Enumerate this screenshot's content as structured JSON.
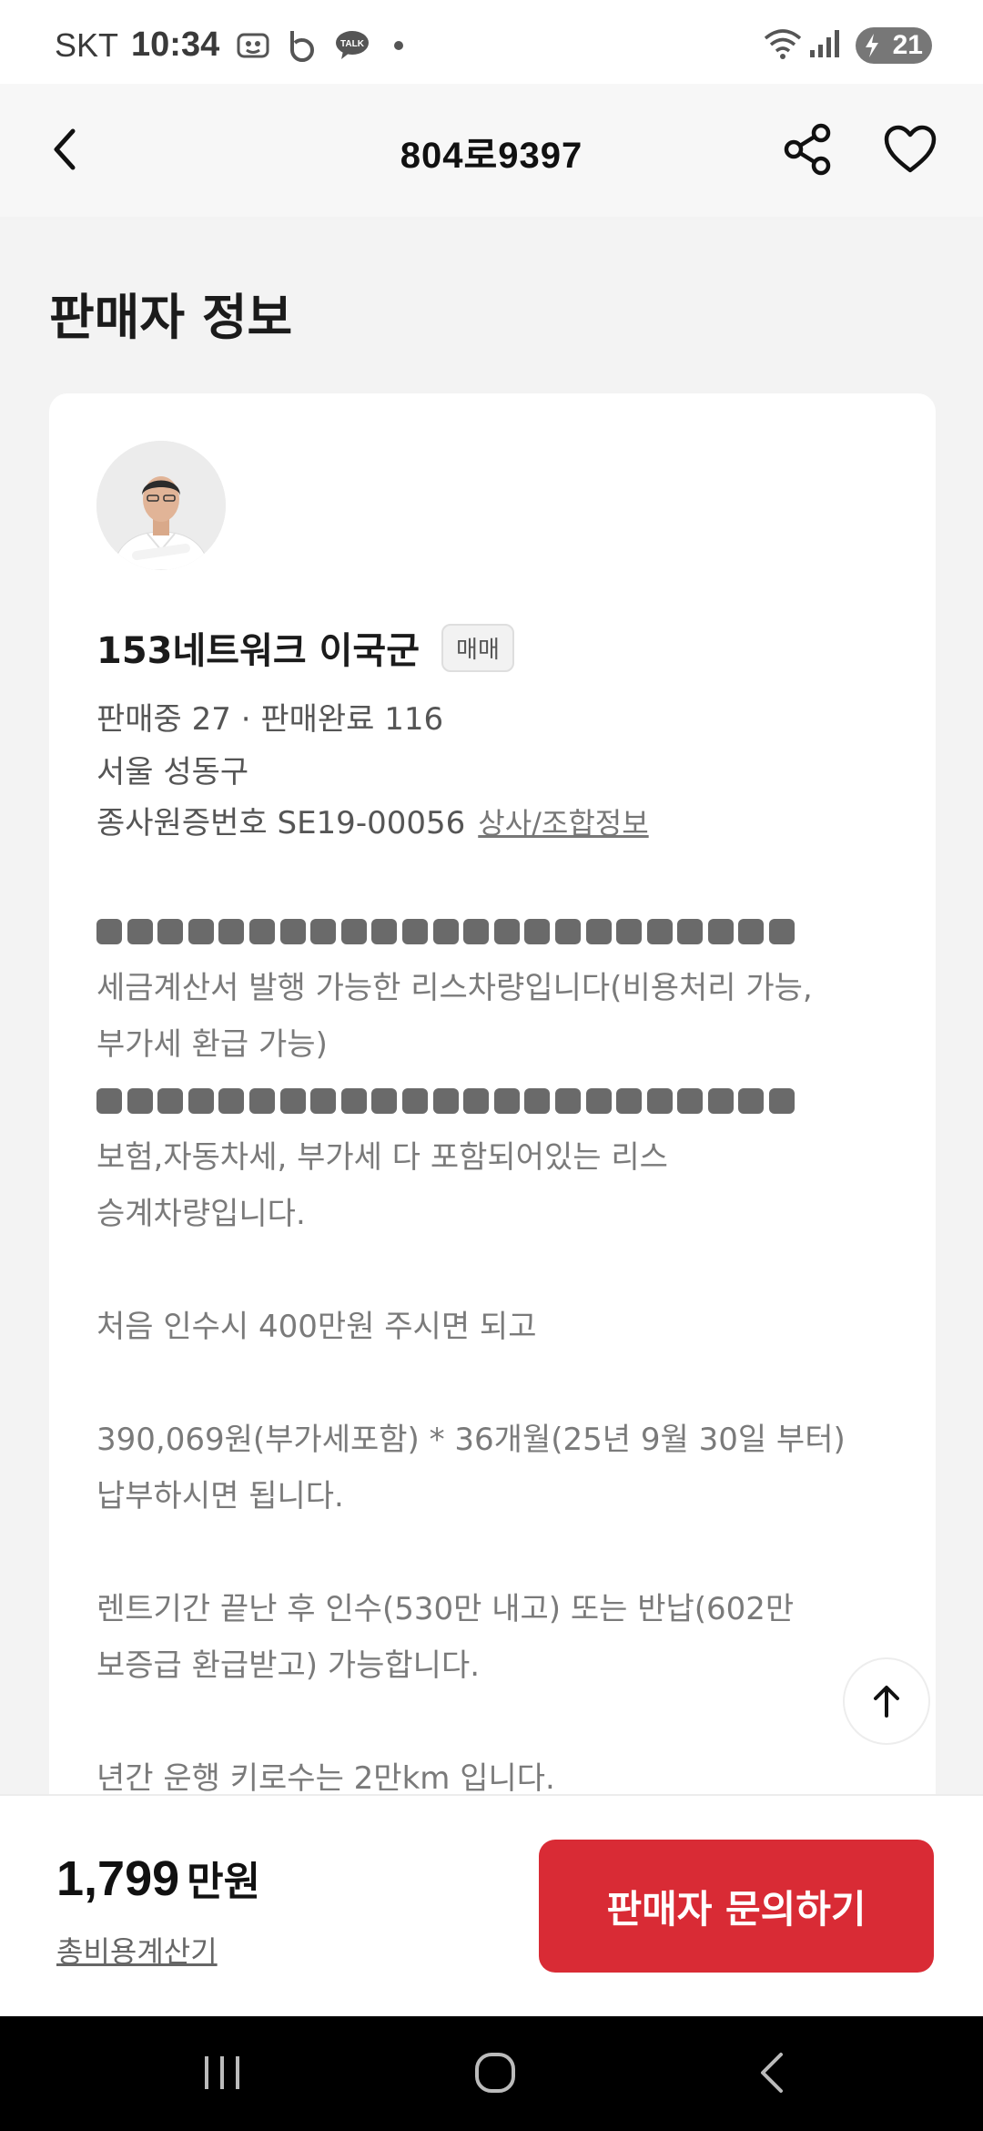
{
  "status_bar": {
    "carrier": "SKT",
    "time": "10:34",
    "battery": "21",
    "icons": [
      "screenshot-icon",
      "b-app-icon",
      "talk-icon",
      "dot-icon",
      "wifi-icon",
      "signal-icon",
      "battery-icon"
    ]
  },
  "header": {
    "title": "804로9397",
    "icons": [
      "back-arrow-icon",
      "share-icon",
      "heart-icon"
    ]
  },
  "section_title": "판매자 정보",
  "seller": {
    "name": "153네트워크 이국군",
    "badge": "매매",
    "stats": "판매중 27 · 판매완료 116",
    "location": "서울 성동구",
    "license": "종사원증번호 SE19-00056",
    "info_link": "상사/조합정보"
  },
  "description": {
    "line1": "세금계산서 발행 가능한 리스차량입니다(비용처리 가능,",
    "line2": "부가세 환급 가능)",
    "line3": "보험,자동차세, 부가세 다 포함되어있는 리스",
    "line4": "승계차량입니다.",
    "line5": "처음 인수시 400만원 주시면 되고",
    "line6": "390,069원(부가세포함) * 36개월(25년 9월 30일 부터)",
    "line7": "납부하시면 됩니다.",
    "line8": "렌트기간 끝난 후 인수(530만 내고) 또는 반납(602만",
    "line9": "보증급 환급받고) 가능합니다.",
    "line10": "년간 운행 키로수는 2만km 입니다."
  },
  "bottom": {
    "price": "1,799",
    "price_unit": "만원",
    "calc_link": "총비용계산기",
    "cta": "판매자 문의하기"
  },
  "nav": {
    "icons": [
      "recent-apps-icon",
      "home-icon",
      "nav-back-icon"
    ]
  },
  "colors": {
    "accent": "#d92b35",
    "background": "#f3f3f3",
    "card": "#ffffff"
  }
}
